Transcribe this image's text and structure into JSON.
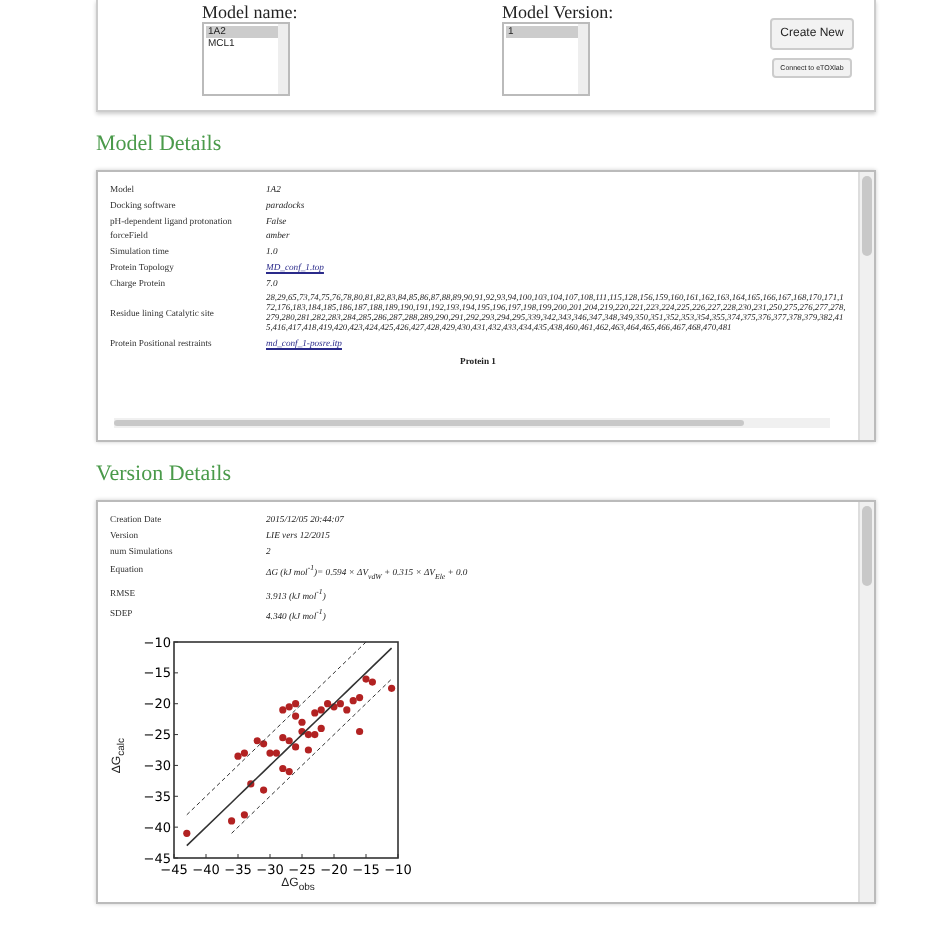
{
  "selector": {
    "model_label": "Model name:",
    "version_label": "Model Version:",
    "models": [
      {
        "label": "1A2",
        "selected": true
      },
      {
        "label": "MCL1",
        "selected": false
      }
    ],
    "versions": [
      {
        "label": "1",
        "selected": true
      }
    ],
    "create_button": "Create New",
    "connect_button": "Connect to eTOXlab"
  },
  "model_details": {
    "heading": "Model Details",
    "rows": [
      {
        "kind": "text",
        "label": "Model",
        "value": "1A2"
      },
      {
        "kind": "text",
        "label": "Docking software",
        "value": "paradocks"
      },
      {
        "kind": "text",
        "label": "pH-dependent ligand protonation",
        "value": "False"
      },
      {
        "kind": "text",
        "label": "forceField",
        "value": "amber"
      },
      {
        "kind": "text",
        "label": "Simulation time",
        "value": "1.0"
      },
      {
        "kind": "link",
        "label": "Protein Topology",
        "value": "MD_conf_1.top"
      },
      {
        "kind": "text",
        "label": "Charge Protein",
        "value": "7.0"
      },
      {
        "kind": "residues",
        "label": "Residue lining Catalytic site",
        "value": "28,29,65,73,74,75,76,78,80,81,82,83,84,85,86,87,88,89,90,91,92,93,94,100,103,104,107,108,111,115,128,156,159,160,161,162,163,164,165,166,167,168,170,171,172,176,183,184,185,186,187,188,189,190,191,192,193,194,195,196,197,198,199,200,201,204,219,220,221,223,224,225,226,227,228,230,231,250,275,276,277,278,279,280,281,282,283,284,285,286,287,288,289,290,291,292,293,294,295,339,342,343,346,347,348,349,350,351,352,353,354,355,374,375,376,377,378,379,382,415,416,417,418,419,420,423,424,425,426,427,428,429,430,431,432,433,434,435,438,460,461,462,463,464,465,466,467,468,470,481"
      },
      {
        "kind": "link",
        "label": "Protein Positional restraints",
        "value": "md_conf_1-posre.itp"
      },
      {
        "kind": "group",
        "label": "Protein 1"
      }
    ]
  },
  "version_details": {
    "heading": "Version Details",
    "rows": [
      {
        "label": "Creation Date",
        "value": "2015/12/05 20:44:07"
      },
      {
        "label": "Version",
        "value": "LIE vers 12/2015"
      },
      {
        "label": "num Simulations",
        "value": "2"
      },
      {
        "label": "Equation",
        "value": "ΔG (kJ mol$^{-1}$)= 0.594 × ΔV$_{vdW}$ + 0.315 × ΔV$_{Ele}$ + 0.0"
      },
      {
        "label": "RMSE",
        "value": "3.913 (kJ mol$^{-1}$)"
      },
      {
        "label": "SDEP",
        "value": "4.340 (kJ mol$^{-1}$)"
      }
    ],
    "chart_data": {
      "type": "scatter",
      "xlabel": "ΔG$_{obs}$",
      "ylabel": "ΔG$_{calc}$",
      "xlim": [
        -45,
        -10
      ],
      "ylim": [
        -45,
        -10
      ],
      "xticks": [
        -45,
        -40,
        -35,
        -30,
        -25,
        -20,
        -15,
        -10
      ],
      "yticks": [
        -45,
        -40,
        -35,
        -30,
        -25,
        -20,
        -15,
        -10
      ],
      "x": [
        -43,
        -36,
        -34,
        -33,
        -31,
        -35,
        -34,
        -32,
        -31,
        -30,
        -29,
        -28,
        -27,
        -28,
        -27,
        -26,
        -26,
        -25,
        -25,
        -24,
        -23,
        -22,
        -21,
        -20,
        -19,
        -18,
        -17,
        -16,
        -15,
        -14,
        -11,
        -16,
        -24,
        -28,
        -27,
        -23,
        -22,
        -26
      ],
      "series": [
        {
          "type": "scatter",
          "color": "#b22222",
          "values": [
            -41,
            -39,
            -38,
            -33,
            -34,
            -28.5,
            -28,
            -26,
            -26.5,
            -28,
            -28,
            -25.5,
            -26,
            -21,
            -20.5,
            -20,
            -22,
            -23,
            -24.5,
            -25,
            -21.5,
            -21,
            -20,
            -20.5,
            -20,
            -21,
            -19.5,
            -19,
            -16,
            -16.5,
            -17.5,
            -24.5,
            -27.5,
            -30.5,
            -31,
            -25,
            -24,
            -27
          ]
        },
        {
          "type": "line",
          "line_style": "solid",
          "color": "#333333",
          "values": [
            -43,
            -36,
            -34,
            -33,
            -31,
            -35,
            -34,
            -32,
            -31,
            -30,
            -29,
            -28,
            -27,
            -28,
            -27,
            -26,
            -26,
            -25,
            -25,
            -24,
            -23,
            -22,
            -21,
            -20,
            -19,
            -18,
            -17,
            -16,
            -15,
            -14,
            -11,
            -16,
            -24,
            -28,
            -27,
            -23,
            -22,
            -26
          ]
        },
        {
          "type": "line",
          "line_style": "dashed",
          "color": "#333333",
          "values": [
            -38,
            -31,
            -29,
            -28,
            -26,
            -30,
            -29,
            -27,
            -26,
            -25,
            -24,
            -23,
            -22,
            -23,
            -22,
            -21,
            -21,
            -20,
            -20,
            -19,
            -18,
            -17,
            -16,
            -15,
            -14,
            -13,
            -12,
            -11,
            -10,
            null,
            null,
            -11,
            -19,
            -23,
            -22,
            -18,
            -17,
            -21
          ]
        },
        {
          "type": "line",
          "line_style": "dashed",
          "color": "#333333",
          "values": [
            null,
            -41,
            -39,
            -38,
            -36,
            -40,
            -39,
            -37,
            -36,
            -35,
            -34,
            -33,
            -32,
            -33,
            -32,
            -31,
            -31,
            -30,
            -30,
            -29,
            -28,
            -27,
            -26,
            -25,
            -24,
            -23,
            -22,
            -21,
            -20,
            -19,
            -16,
            -21,
            -29,
            -33,
            -32,
            -28,
            -27,
            -31
          ]
        }
      ]
    }
  }
}
